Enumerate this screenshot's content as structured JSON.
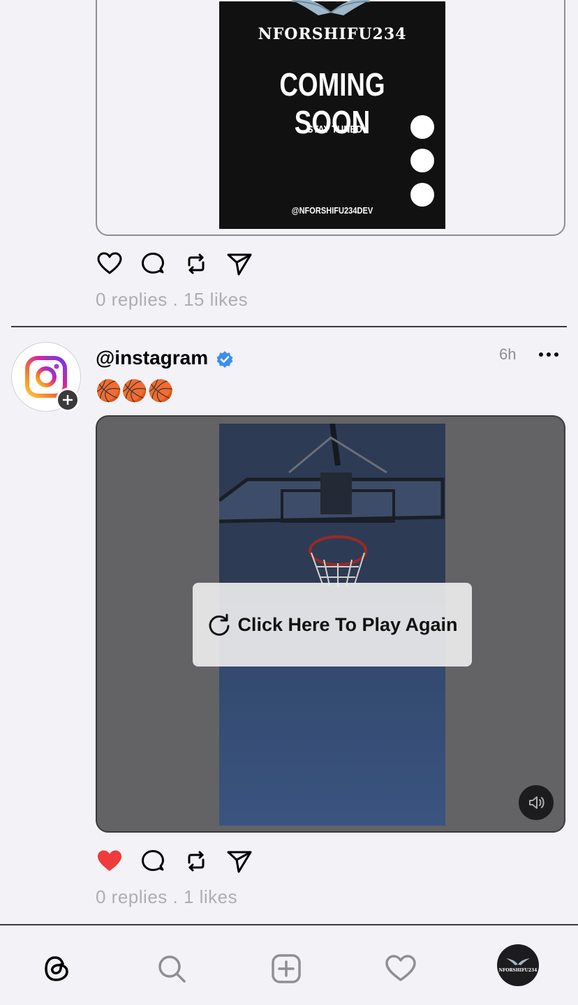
{
  "post1": {
    "poster": {
      "brand": "NFORSHIFU234",
      "headline": "COMING SOON",
      "subline": "STAY TUNED",
      "handle": "@NFORSHIFU234DEV"
    },
    "stats": "0 replies . 15 likes",
    "liked": false
  },
  "post2": {
    "username": "@instagram",
    "verified": true,
    "time": "6h",
    "caption": "🏀🏀🏀",
    "replay_label": "Click Here To Play Again",
    "stats": "0 replies . 1 likes",
    "liked": true
  },
  "tabbar": {
    "items": [
      "threads-home-icon",
      "search-icon",
      "compose-icon",
      "activity-heart-icon",
      "profile-avatar"
    ],
    "profile_text": "NFORSHIFU234"
  },
  "colors": {
    "like_red": "#ee3b3b",
    "verified_blue": "#3d8ef0",
    "muted_text": "#aeaeb2"
  }
}
